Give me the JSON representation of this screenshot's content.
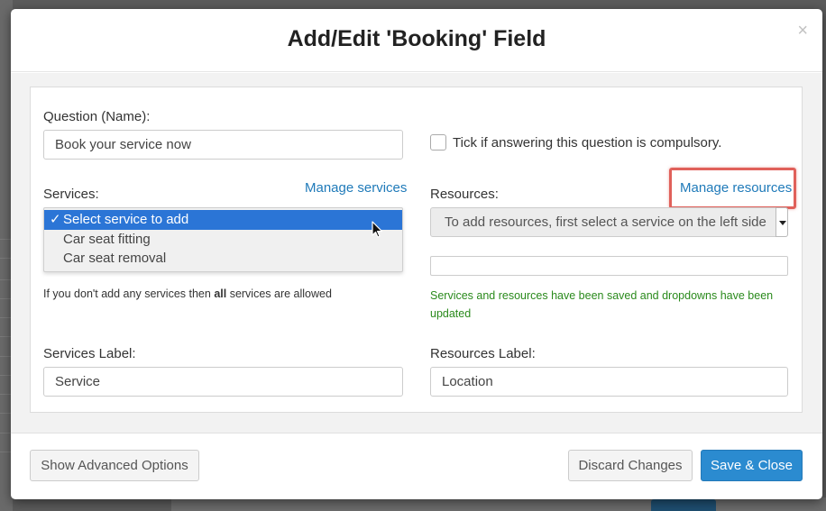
{
  "modal": {
    "title": "Add/Edit 'Booking' Field",
    "close_symbol": "×"
  },
  "question": {
    "label": "Question (Name):",
    "value": "Book your service now"
  },
  "compulsory": {
    "label": "Tick if answering this question is compulsory.",
    "checked": false
  },
  "services": {
    "label": "Services:",
    "manage_link": "Manage services",
    "options": [
      {
        "label": "Select service to add",
        "selected": true
      },
      {
        "label": "Car seat fitting",
        "selected": false
      },
      {
        "label": "Car seat removal",
        "selected": false
      }
    ],
    "checkmark": "✓",
    "help_prefix": "If you don't add any services then ",
    "help_bold": "all",
    "help_suffix": " services are allowed"
  },
  "resources": {
    "label": "Resources:",
    "manage_link": "Manage resources",
    "select_value": "To add resources, first select a service on the left side",
    "status_message": "Services and resources have been saved and dropdowns have been updated"
  },
  "services_label": {
    "label": "Services Label:",
    "value": "Service"
  },
  "resources_label": {
    "label": "Resources Label:",
    "value": "Location"
  },
  "footer": {
    "advanced_button": "Show Advanced Options",
    "discard_button": "Discard Changes",
    "save_button": "Save & Close"
  },
  "colors": {
    "link": "#1f7ab9",
    "primary": "#2b8bd0",
    "highlight": "#e0605a",
    "success": "#2a8a1c",
    "selected_option": "#2b75d6"
  }
}
